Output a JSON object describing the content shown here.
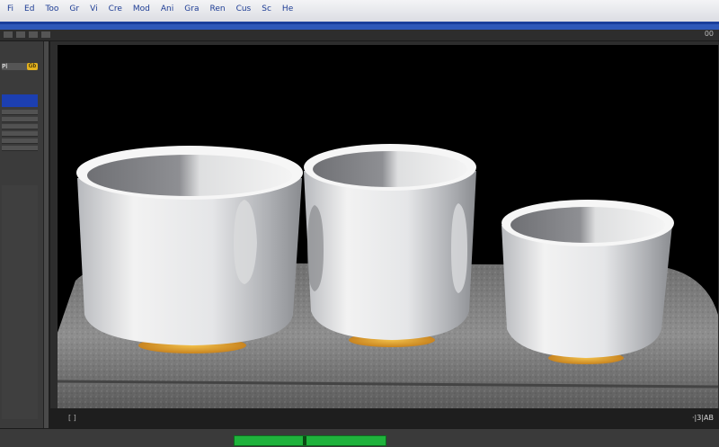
{
  "menu": {
    "items": [
      "Fi",
      "Ed",
      "Too",
      "Gr",
      "Vi",
      "Cre",
      "Mod",
      "Ani",
      "Gra",
      "Ren",
      "Cus",
      "Sc",
      "He"
    ]
  },
  "toolbar": {
    "readout": "00"
  },
  "left_panel": {
    "header_label": "Pl",
    "badge_label": "Gb"
  },
  "viewport": {
    "frame_label": "[  ]",
    "stats_label": "·|3|AB"
  },
  "scene": {
    "object_count": 3,
    "objects": [
      "cup-left",
      "cup-middle",
      "cup-right"
    ]
  },
  "timeline": {
    "fill_fraction": 1.0,
    "marker_fraction": 0.45
  },
  "colors": {
    "accent": "#1a3f9c",
    "timeline": "#1fb33c",
    "background": "#4a4a4a",
    "scene_bg": "#000000",
    "cup_white": "#f2f2f2",
    "cup_base_glow": "#e0a12a"
  }
}
